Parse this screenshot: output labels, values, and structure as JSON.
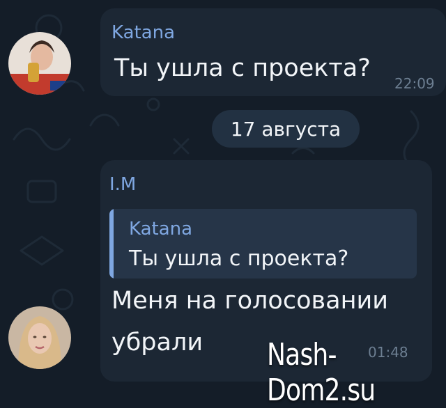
{
  "messages": [
    {
      "sender": "Katana",
      "text": "Ты ушла с проекта?",
      "time": "22:09",
      "avatar": "avatar-katana"
    },
    {
      "sender": "I.M",
      "reply_to": {
        "sender": "Katana",
        "text": "Ты ушла с проекта?"
      },
      "text_line1": "Меня на голосовании",
      "text_line2": "убрали",
      "time": "01:48",
      "avatar": "avatar-im"
    }
  ],
  "date_separator": "17 августа",
  "watermark": "Nash-Dom2.su",
  "colors": {
    "background": "#141d28",
    "bubble": "#1c2734",
    "sender_name": "#7fa7e1",
    "message_text": "#f2f5f8",
    "timestamp": "#6d7f92",
    "date_pill": "#223142",
    "quote_background": "#263548"
  }
}
